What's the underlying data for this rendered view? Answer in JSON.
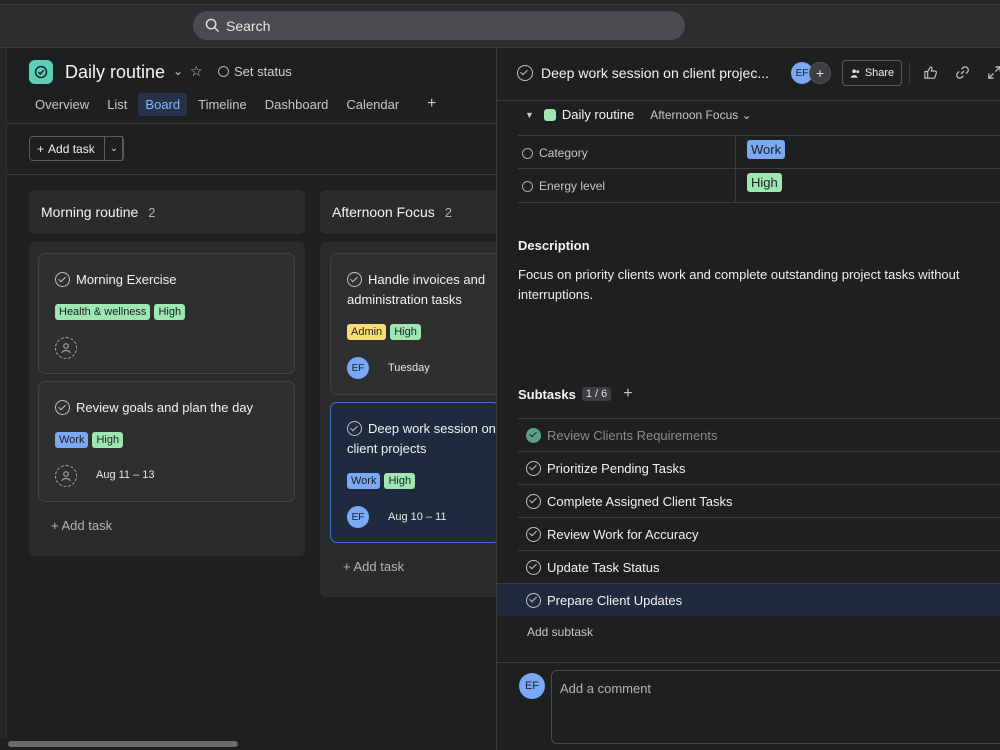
{
  "search": {
    "label": "Search"
  },
  "project": {
    "title": "Daily routine",
    "set_status": "Set status"
  },
  "tabs": [
    {
      "label": "Overview"
    },
    {
      "label": "List"
    },
    {
      "label": "Board"
    },
    {
      "label": "Timeline"
    },
    {
      "label": "Dashboard"
    },
    {
      "label": "Calendar"
    }
  ],
  "toolbar": {
    "add_task": "Add task"
  },
  "columns": [
    {
      "name": "Morning routine",
      "count": "2",
      "add_task": "Add task",
      "cards": [
        {
          "title": "Morning Exercise",
          "tags": [
            "Health & wellness",
            "High"
          ]
        },
        {
          "title": "Review goals and plan the day",
          "tags": [
            "Work",
            "High"
          ],
          "due": "Aug 11 – 13"
        }
      ]
    },
    {
      "name": "Afternoon Focus",
      "count": "2",
      "add_task": "Add task",
      "cards": [
        {
          "title": "Handle invoices and administration tasks",
          "tags": [
            "Admin",
            "High"
          ],
          "assignee": "EF",
          "due": "Tuesday"
        },
        {
          "title": "Deep work session on client projects",
          "tags": [
            "Work",
            "High"
          ],
          "assignee": "EF",
          "due": "Aug 10 – 11"
        }
      ]
    }
  ],
  "detail": {
    "title": "Deep work session on client projec...",
    "assignee": "EF",
    "share": "Share",
    "project": "Daily routine",
    "section": "Afternoon Focus",
    "fields": [
      {
        "label": "Category",
        "value": "Work"
      },
      {
        "label": "Energy level",
        "value": "High"
      }
    ],
    "description_heading": "Description",
    "description": "Focus on priority clients work and complete outstanding project tasks without interruptions.",
    "subtasks_heading": "Subtasks",
    "subtasks_count": "1 / 6",
    "subtasks": [
      {
        "label": "Review Clients Requirements",
        "done": true
      },
      {
        "label": "Prioritize Pending Tasks"
      },
      {
        "label": "Complete Assigned Client Tasks"
      },
      {
        "label": "Review Work for Accuracy"
      },
      {
        "label": "Update Task Status"
      },
      {
        "label": "Prepare Client Updates"
      }
    ],
    "add_subtask": "Add subtask",
    "comment_avatar": "EF",
    "comment_placeholder": "Add a comment"
  },
  "colors": {
    "accent": "#4573d2",
    "tag_green": "#9ee7b1",
    "tag_blue": "#7aa9f5",
    "tag_yellow": "#f8df72",
    "project_icon": "#5ccfb8"
  }
}
